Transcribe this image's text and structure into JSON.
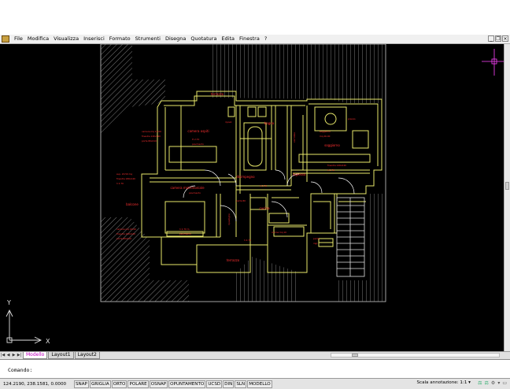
{
  "menu": {
    "items": [
      "File",
      "Modifica",
      "Visualizza",
      "Inserisci",
      "Formato",
      "Strumenti",
      "Disegna",
      "Quotatura",
      "Edita",
      "Finestra",
      "?"
    ]
  },
  "window_controls": {
    "minimize": "_",
    "restore": "❐",
    "close": "×"
  },
  "drawing": {
    "rooms": [
      {
        "key": "n1",
        "label": "terrazzo"
      },
      {
        "key": "n2",
        "label": "camera ospiti"
      },
      {
        "key": "n3",
        "label": "bagno"
      },
      {
        "key": "n4",
        "label": "soggiorno"
      },
      {
        "key": "n5",
        "label": "disimpegno"
      },
      {
        "key": "n6",
        "label": "camera matrimoniale"
      },
      {
        "key": "n7",
        "label": "cucina"
      },
      {
        "key": "n8",
        "label": "ingresso"
      },
      {
        "key": "n9",
        "label": "balcone"
      },
      {
        "key": "n10",
        "label": "terrazzo"
      }
    ],
    "ucs": {
      "x_label": "X",
      "y_label": "Y"
    }
  },
  "tabs": {
    "items": [
      "Modello",
      "Layout1",
      "Layout2"
    ],
    "active": "Modello"
  },
  "command": {
    "prompt": "Comando:"
  },
  "status": {
    "coords": "124.2190, 238.1581, 0.0000",
    "toggles": [
      "SNAP",
      "GRIGLIA",
      "ORTO",
      "POLARE",
      "OSNAP",
      "OPUNTAMENTO",
      "UCSD",
      "DIN",
      "SLN",
      "MODELLO"
    ],
    "annotation_label": "Scala annotazione:",
    "annotation_value": "1:1"
  },
  "colors": {
    "background": "#000000",
    "walls": "#e8e86a",
    "text": "#ff3030",
    "outline": "#ffffff",
    "crosshair": "#ff44ff"
  }
}
